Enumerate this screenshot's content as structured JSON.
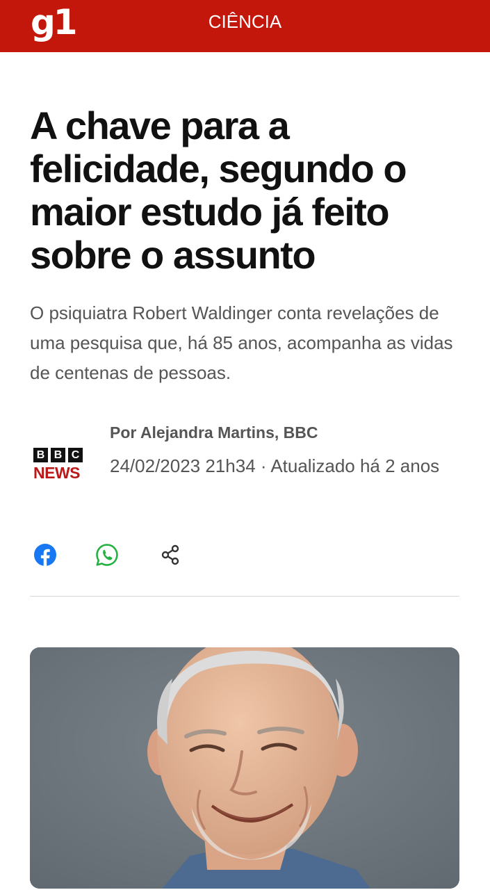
{
  "header": {
    "logo": "g1",
    "section": "CIÊNCIA",
    "brand_color": "#c4170c"
  },
  "article": {
    "title": "A chave para a felicidade, segundo o maior estudo já feito sobre o assunto",
    "subtitle": "O psiquiatra Robert Waldinger conta revelações de uma pesquisa que, há 85 anos, acompanha as vidas de centenas de pessoas.",
    "source_logo": {
      "letters": [
        "B",
        "B",
        "C"
      ],
      "word": "NEWS"
    },
    "author": "Por Alejandra Martins, BBC",
    "meta": "24/02/2023 21h34 · Atualizado há 2 anos"
  },
  "share": {
    "icons": [
      "facebook-icon",
      "whatsapp-icon",
      "share-icon"
    ],
    "colors": {
      "facebook": "#1877f2",
      "whatsapp": "#25b042",
      "share": "#333333"
    }
  },
  "media": {
    "image": "portrait-photo"
  }
}
